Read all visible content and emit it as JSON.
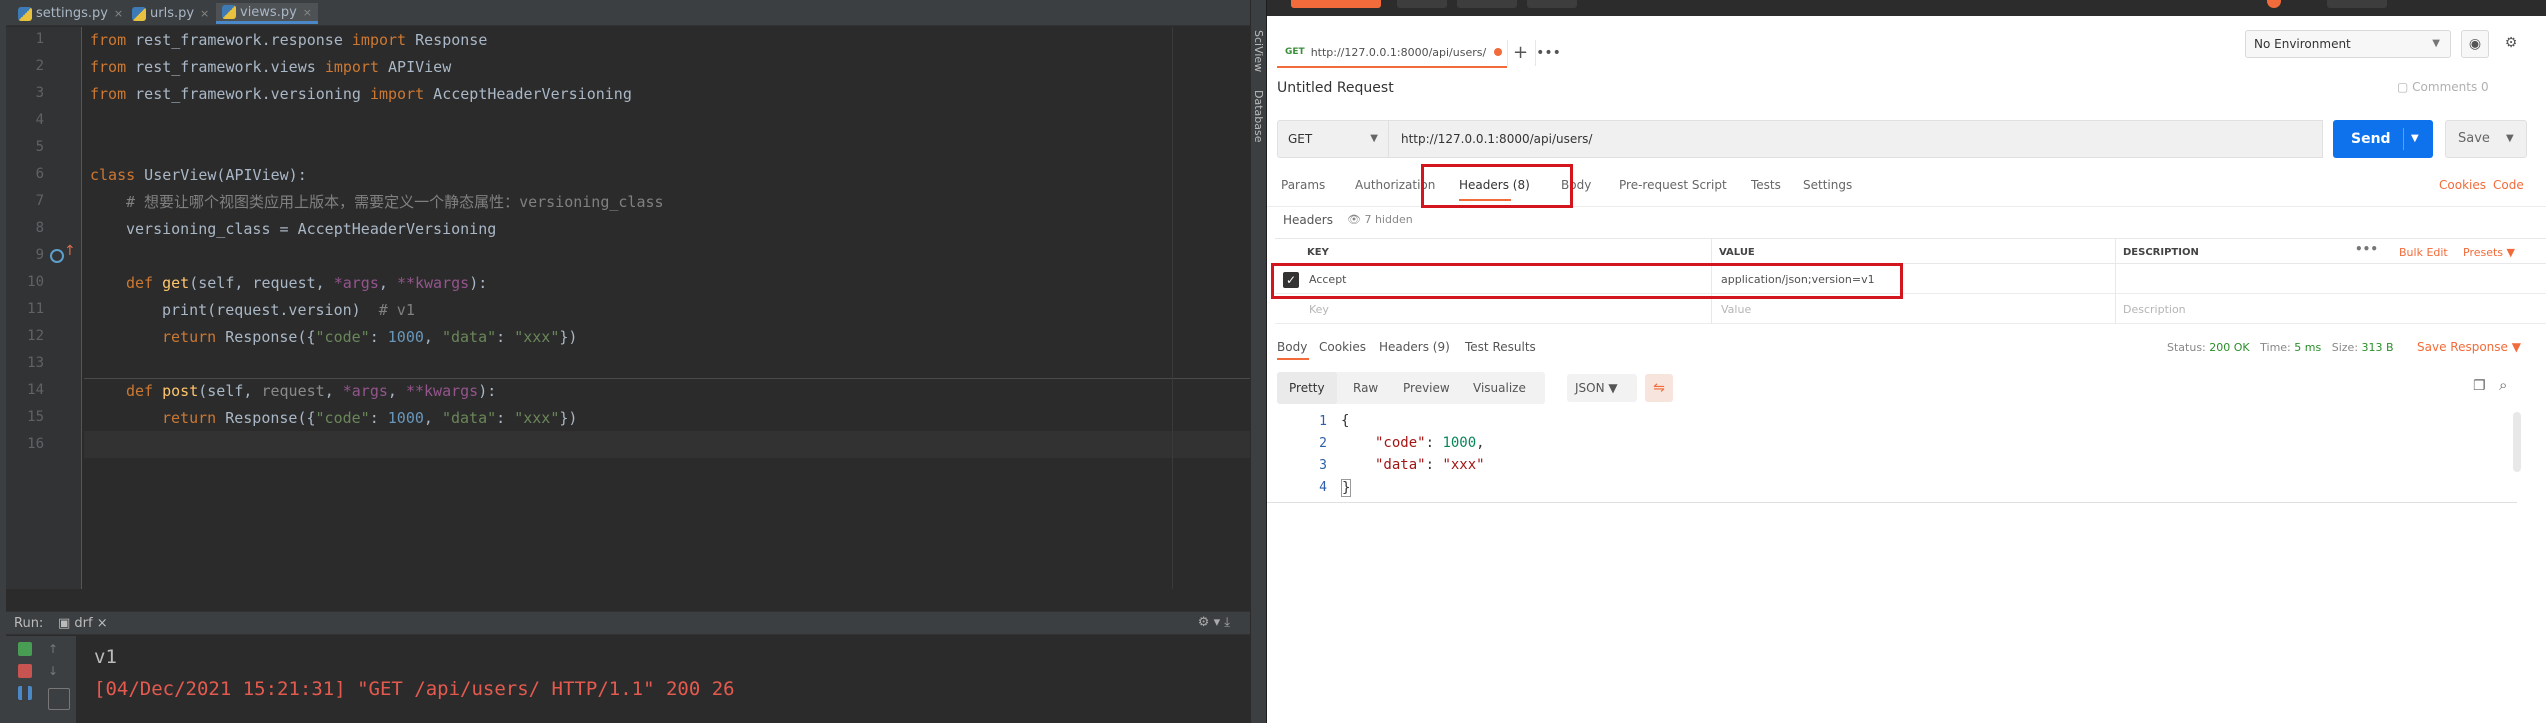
{
  "ide": {
    "tabs": [
      {
        "label": "settings.py",
        "active": false
      },
      {
        "label": "urls.py",
        "active": false
      },
      {
        "label": "views.py",
        "active": true
      }
    ],
    "line_numbers": [
      "1",
      "2",
      "3",
      "4",
      "5",
      "6",
      "7",
      "8",
      "9",
      "10",
      "11",
      "12",
      "13",
      "14",
      "15",
      "16"
    ],
    "code": {
      "l1": [
        "from",
        " rest_framework.response ",
        "import",
        " Response"
      ],
      "l2": [
        "from",
        " rest_framework.views ",
        "import",
        " APIView"
      ],
      "l3": [
        "from",
        " rest_framework.versioning ",
        "import",
        " AcceptHeaderVersioning"
      ],
      "l6": [
        "class",
        " UserView(APIView):"
      ],
      "l7": "# 想要让哪个视图类应用上版本，需要定义一个静态属性：versioning_class",
      "l8": "versioning_class = AcceptHeaderVersioning",
      "l10": [
        "def",
        " ",
        "get",
        "(self, request, ",
        "*args",
        ", ",
        "**kwargs",
        "):"
      ],
      "l11": [
        "print(request.version)",
        "  # v1"
      ],
      "l12": [
        "return",
        " Response({",
        "\"code\"",
        ": ",
        "1000",
        ", ",
        "\"data\"",
        ": ",
        "\"xxx\"",
        "})"
      ],
      "l14": [
        "def",
        " ",
        "post",
        "(self, ",
        "request",
        ", ",
        "*args",
        ", ",
        "**kwargs",
        "):"
      ],
      "l15": [
        "return",
        " Response({",
        "\"code\"",
        ": ",
        "1000",
        ", ",
        "\"data\"",
        ": ",
        "\"xxx\"",
        "})"
      ]
    },
    "run": {
      "label": "Run:",
      "config": "drf",
      "output_line1": "v1",
      "output_line2": "[04/Dec/2021 15:21:31] \"GET /api/users/ HTTP/1.1\" 200 26"
    },
    "side_labels": [
      "SciView",
      "Database"
    ]
  },
  "postman": {
    "request_tab": {
      "method": "GET",
      "url": "http://127.0.0.1:8000/api/users/"
    },
    "environment": "No Environment",
    "request_title": "Untitled Request",
    "comments": "Comments",
    "comments_count": "0",
    "method": "GET",
    "url": "http://127.0.0.1:8000/api/users/",
    "send_label": "Send",
    "save_label": "Save",
    "request_tabs": [
      "Params",
      "Authorization",
      "Headers (8)",
      "Body",
      "Pre-request Script",
      "Tests",
      "Settings"
    ],
    "cookies_link": "Cookies",
    "code_link": "Code",
    "headers_label": "Headers",
    "hidden_label": "7 hidden",
    "table": {
      "columns": [
        "KEY",
        "VALUE",
        "DESCRIPTION"
      ],
      "bulk_edit": "Bulk Edit",
      "presets": "Presets",
      "rows": [
        {
          "key": "Accept",
          "value": "application/json;version=v1",
          "description": "",
          "checked": true
        }
      ],
      "placeholder": {
        "key": "Key",
        "value": "Value",
        "description": "Description"
      }
    },
    "response_tabs": [
      "Body",
      "Cookies",
      "Headers (9)",
      "Test Results"
    ],
    "status": {
      "label": "Status:",
      "value": "200 OK",
      "time_label": "Time:",
      "time": "5 ms",
      "size_label": "Size:",
      "size": "313 B"
    },
    "save_response": "Save Response",
    "format_tabs": [
      "Pretty",
      "Raw",
      "Preview",
      "Visualize"
    ],
    "format_select": "JSON",
    "body_line_numbers": [
      "1",
      "2",
      "3",
      "4"
    ],
    "body": {
      "open": "{",
      "code_key": "\"code\"",
      "code_val": "1000",
      "data_key": "\"data\"",
      "data_val": "\"xxx\"",
      "close": "}"
    }
  }
}
